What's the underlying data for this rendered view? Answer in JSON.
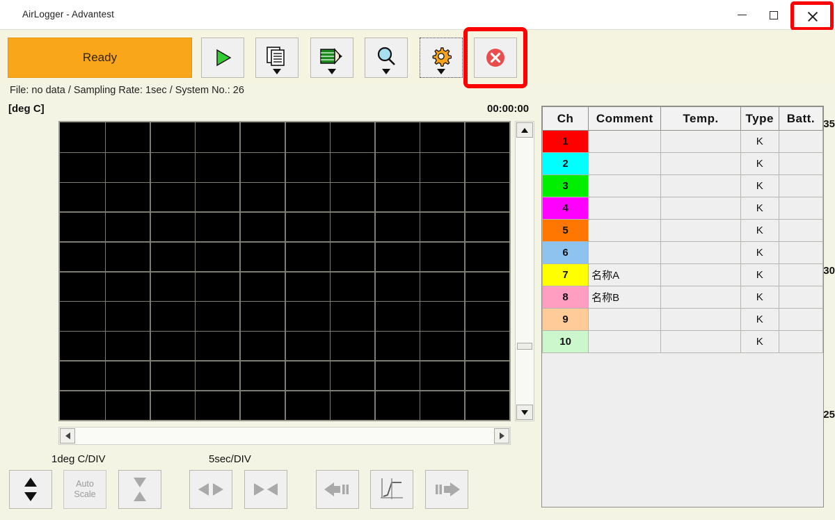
{
  "window": {
    "title": "AirLogger - Advantest",
    "minimize_label": "–",
    "maximize_label": "□",
    "close_label": "✕"
  },
  "toolbar": {
    "status_label": "Ready",
    "status_color": "#faa61a",
    "buttons": [
      {
        "name": "run-button",
        "icon": "play-triangle-icon"
      },
      {
        "name": "file-button",
        "icon": "documents-icon"
      },
      {
        "name": "edit-button",
        "icon": "pencil-icon"
      },
      {
        "name": "zoom-button",
        "icon": "magnifier-icon"
      },
      {
        "name": "settings-button",
        "icon": "gear-icon"
      },
      {
        "name": "stop-button",
        "icon": "stop-circle-x-icon"
      }
    ],
    "highlight_color": "#ff0000"
  },
  "status": {
    "line": "File: no data  / Sampling Rate: 1sec / System No.: 26",
    "file": "no data",
    "sampling_rate": "1sec",
    "system_no": "26"
  },
  "graph": {
    "unit_label": "[deg C]",
    "elapsed_time": "00:00:00",
    "y_ticks": [
      "+35",
      "+30",
      "+25"
    ],
    "y_per_div": "1deg C/DIV",
    "x_per_div": "5sec/DIV",
    "grid_columns": 10,
    "grid_rows": 10,
    "background": "#000000",
    "grid_color": "#7d7d74"
  },
  "chart_data": {
    "type": "line",
    "title": "",
    "xlabel": "",
    "ylabel": "[deg C]",
    "ylim": [
      25,
      35
    ],
    "y_ticks": [
      25,
      30,
      35
    ],
    "y_per_div": 1,
    "x_per_div": 5,
    "x_unit": "sec",
    "grid": true,
    "series": []
  },
  "bottom_controls": [
    {
      "name": "y-scale-button",
      "icon": "up-down-arrows-icon",
      "label": ""
    },
    {
      "name": "auto-scale-button",
      "icon": "",
      "label": "Auto Scale",
      "line1": "Auto",
      "line2": "Scale",
      "disabled": true
    },
    {
      "name": "y-zoom-button",
      "icon": "hourglass-arrows-icon",
      "label": ""
    },
    {
      "name": "x-expand-button",
      "icon": "left-right-arrows-icon",
      "label": ""
    },
    {
      "name": "x-compress-button",
      "icon": "inward-arrows-icon",
      "label": ""
    },
    {
      "name": "scroll-back-button",
      "icon": "left-arrow-bars-icon",
      "label": ""
    },
    {
      "name": "cursor-button",
      "icon": "trend-line-icon",
      "label": ""
    },
    {
      "name": "scroll-forward-button",
      "icon": "right-arrow-bars-icon",
      "label": ""
    }
  ],
  "channel_table": {
    "headers": [
      "Ch",
      "Comment",
      "Temp.",
      "Type",
      "Batt."
    ],
    "rows": [
      {
        "ch": "1",
        "color": "#ff0000",
        "comment": "",
        "temp": "",
        "type": "K",
        "batt": ""
      },
      {
        "ch": "2",
        "color": "#00ffff",
        "comment": "",
        "temp": "",
        "type": "K",
        "batt": ""
      },
      {
        "ch": "3",
        "color": "#00ee00",
        "comment": "",
        "temp": "",
        "type": "K",
        "batt": ""
      },
      {
        "ch": "4",
        "color": "#ff00ff",
        "comment": "",
        "temp": "",
        "type": "K",
        "batt": ""
      },
      {
        "ch": "5",
        "color": "#ff7700",
        "comment": "",
        "temp": "",
        "type": "K",
        "batt": ""
      },
      {
        "ch": "6",
        "color": "#8ec3f0",
        "comment": "",
        "temp": "",
        "type": "K",
        "batt": ""
      },
      {
        "ch": "7",
        "color": "#ffff00",
        "comment": "名称A",
        "temp": "",
        "type": "K",
        "batt": ""
      },
      {
        "ch": "8",
        "color": "#ff9ec0",
        "comment": "名称B",
        "temp": "",
        "type": "K",
        "batt": ""
      },
      {
        "ch": "9",
        "color": "#ffcc99",
        "comment": "",
        "temp": "",
        "type": "K",
        "batt": ""
      },
      {
        "ch": "10",
        "color": "#ccf7cc",
        "comment": "",
        "temp": "",
        "type": "K",
        "batt": ""
      }
    ]
  }
}
